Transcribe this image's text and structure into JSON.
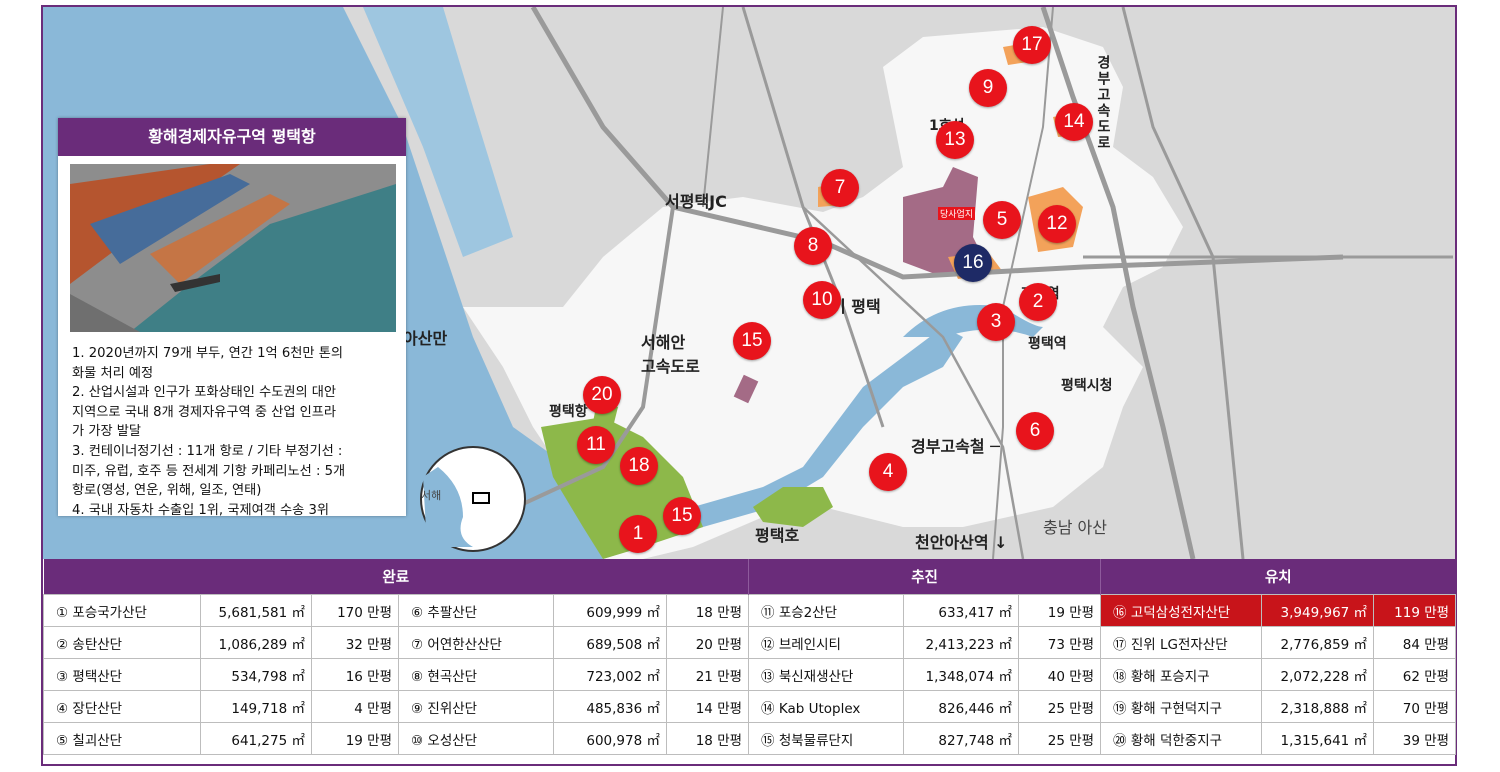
{
  "colors": {
    "accent": "#6a2c7a",
    "marker": "#e8141c",
    "marker_special": "#1e2a66",
    "highlight": "#c8141a"
  },
  "infobox": {
    "title": "황해경제자유구역 평택항",
    "lines": [
      "1. 2020년까지 79개 부두, 연간 1억 6천만 톤의",
      "화물 처리 예정",
      "2. 산업시설과 인구가 포화상태인 수도권의 대안",
      "지역으로 국내 8개 경제자유구역 중 산업 인프라",
      "가 가장 발달",
      "3. 컨테이너정기선 : 11개 항로 / 기타 부정기선 :",
      "미주, 유럽, 호주 등 전세계 기항 카페리노선 : 5개",
      "항로(영성, 연운, 위해, 일조, 연태)",
      "4. 국내 자동차 수출입 1위, 국제여객 수송 3위"
    ]
  },
  "map_labels": {
    "seo_pyeongtaek_jc": "서평택JC",
    "asan_bay": "아산만",
    "west_coast_highway_1": "서해안",
    "west_coast_highway_2": "고속도로",
    "pyeongtaek_port": "평택항",
    "pyeongtaek_lake": "평택호",
    "jije": "지제역",
    "pyeongtaek_station": "평택역",
    "city_hall": "평택시청",
    "gyeongbu_ktx": "경부고속철 ─",
    "cheonan_asan": "천안아산역 ↓",
    "chungnam_asan": "충남 아산",
    "gyeongbu_expressway": "경부고속도로",
    "road_1": "1호선",
    "west_sea": "서해",
    "company_site": "당사업지",
    "songtan": "기 평택"
  },
  "markers": [
    "1",
    "2",
    "3",
    "4",
    "5",
    "6",
    "7",
    "8",
    "9",
    "10",
    "11",
    "12",
    "13",
    "14",
    "15",
    "15",
    "16",
    "17",
    "18",
    "20"
  ],
  "table": {
    "groups": [
      "완료",
      "추진",
      "유치"
    ],
    "rows": [
      [
        "① 포승국가산단",
        "5,681,581 ㎡",
        "170 만평",
        "⑥ 추팔산단",
        "609,999 ㎡",
        "18 만평",
        "⑪ 포승2산단",
        "633,417 ㎡",
        "19 만평",
        "⑯ 고덕삼성전자산단",
        "3,949,967 ㎡",
        "119 만평"
      ],
      [
        "② 송탄산단",
        "1,086,289 ㎡",
        "32 만평",
        "⑦ 어연한산산단",
        "689,508 ㎡",
        "20 만평",
        "⑫ 브레인시티",
        "2,413,223 ㎡",
        "73 만평",
        "⑰ 진위 LG전자산단",
        "2,776,859 ㎡",
        "84 만평"
      ],
      [
        "③ 평택산단",
        "534,798 ㎡",
        "16 만평",
        "⑧ 현곡산단",
        "723,002 ㎡",
        "21 만평",
        "⑬ 북신재생산단",
        "1,348,074 ㎡",
        "40 만평",
        "⑱ 황해 포승지구",
        "2,072,228 ㎡",
        "62 만평"
      ],
      [
        "④ 장단산단",
        "149,718 ㎡",
        "4 만평",
        "⑨ 진위산단",
        "485,836 ㎡",
        "14 만평",
        "⑭ Kab Utoplex",
        "826,446 ㎡",
        "25 만평",
        "⑲ 황해 구현덕지구",
        "2,318,888 ㎡",
        "70 만평"
      ],
      [
        "⑤ 칠괴산단",
        "641,275 ㎡",
        "19 만평",
        "⑩ 오성산단",
        "600,978 ㎡",
        "18 만평",
        "⑮ 청북물류단지",
        "827,748 ㎡",
        "25 만평",
        "⑳ 황해 덕한중지구",
        "1,315,641 ㎡",
        "39 만평"
      ]
    ]
  }
}
